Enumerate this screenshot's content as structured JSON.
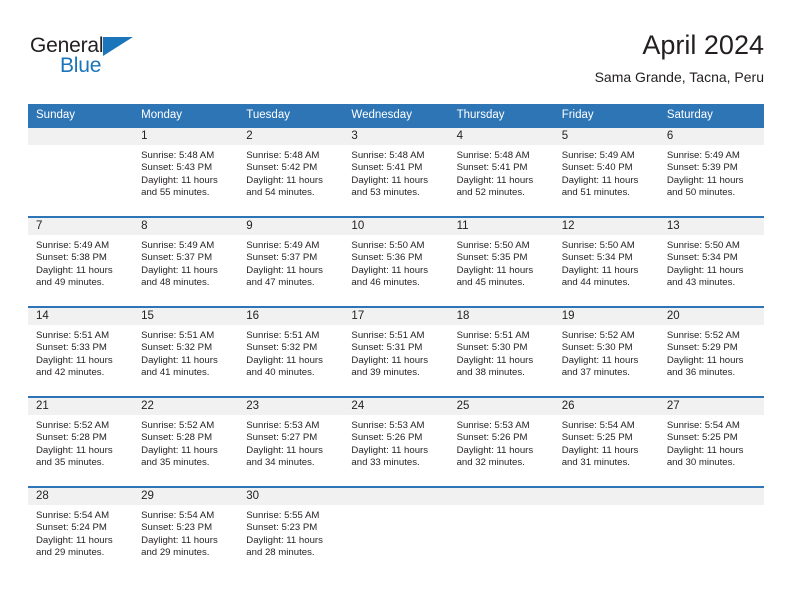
{
  "brand": {
    "name_part1": "General",
    "name_part2": "Blue",
    "triangle_color": "#1b75bb"
  },
  "header": {
    "title": "April 2024",
    "subtitle": "Sama Grande, Tacna, Peru"
  },
  "theme": {
    "header_bg": "#2e75b6",
    "date_band_bg": "#f1f1f1",
    "text": "#231f20",
    "brand_blue": "#1b75bb"
  },
  "weekday_headers": [
    "Sunday",
    "Monday",
    "Tuesday",
    "Wednesday",
    "Thursday",
    "Friday",
    "Saturday"
  ],
  "weeks": [
    [
      {
        "date": "",
        "sunrise": "",
        "sunset": "",
        "daylight_line1": "",
        "daylight_line2": ""
      },
      {
        "date": "1",
        "sunrise": "Sunrise: 5:48 AM",
        "sunset": "Sunset: 5:43 PM",
        "daylight_line1": "Daylight: 11 hours",
        "daylight_line2": "and 55 minutes."
      },
      {
        "date": "2",
        "sunrise": "Sunrise: 5:48 AM",
        "sunset": "Sunset: 5:42 PM",
        "daylight_line1": "Daylight: 11 hours",
        "daylight_line2": "and 54 minutes."
      },
      {
        "date": "3",
        "sunrise": "Sunrise: 5:48 AM",
        "sunset": "Sunset: 5:41 PM",
        "daylight_line1": "Daylight: 11 hours",
        "daylight_line2": "and 53 minutes."
      },
      {
        "date": "4",
        "sunrise": "Sunrise: 5:48 AM",
        "sunset": "Sunset: 5:41 PM",
        "daylight_line1": "Daylight: 11 hours",
        "daylight_line2": "and 52 minutes."
      },
      {
        "date": "5",
        "sunrise": "Sunrise: 5:49 AM",
        "sunset": "Sunset: 5:40 PM",
        "daylight_line1": "Daylight: 11 hours",
        "daylight_line2": "and 51 minutes."
      },
      {
        "date": "6",
        "sunrise": "Sunrise: 5:49 AM",
        "sunset": "Sunset: 5:39 PM",
        "daylight_line1": "Daylight: 11 hours",
        "daylight_line2": "and 50 minutes."
      }
    ],
    [
      {
        "date": "7",
        "sunrise": "Sunrise: 5:49 AM",
        "sunset": "Sunset: 5:38 PM",
        "daylight_line1": "Daylight: 11 hours",
        "daylight_line2": "and 49 minutes."
      },
      {
        "date": "8",
        "sunrise": "Sunrise: 5:49 AM",
        "sunset": "Sunset: 5:37 PM",
        "daylight_line1": "Daylight: 11 hours",
        "daylight_line2": "and 48 minutes."
      },
      {
        "date": "9",
        "sunrise": "Sunrise: 5:49 AM",
        "sunset": "Sunset: 5:37 PM",
        "daylight_line1": "Daylight: 11 hours",
        "daylight_line2": "and 47 minutes."
      },
      {
        "date": "10",
        "sunrise": "Sunrise: 5:50 AM",
        "sunset": "Sunset: 5:36 PM",
        "daylight_line1": "Daylight: 11 hours",
        "daylight_line2": "and 46 minutes."
      },
      {
        "date": "11",
        "sunrise": "Sunrise: 5:50 AM",
        "sunset": "Sunset: 5:35 PM",
        "daylight_line1": "Daylight: 11 hours",
        "daylight_line2": "and 45 minutes."
      },
      {
        "date": "12",
        "sunrise": "Sunrise: 5:50 AM",
        "sunset": "Sunset: 5:34 PM",
        "daylight_line1": "Daylight: 11 hours",
        "daylight_line2": "and 44 minutes."
      },
      {
        "date": "13",
        "sunrise": "Sunrise: 5:50 AM",
        "sunset": "Sunset: 5:34 PM",
        "daylight_line1": "Daylight: 11 hours",
        "daylight_line2": "and 43 minutes."
      }
    ],
    [
      {
        "date": "14",
        "sunrise": "Sunrise: 5:51 AM",
        "sunset": "Sunset: 5:33 PM",
        "daylight_line1": "Daylight: 11 hours",
        "daylight_line2": "and 42 minutes."
      },
      {
        "date": "15",
        "sunrise": "Sunrise: 5:51 AM",
        "sunset": "Sunset: 5:32 PM",
        "daylight_line1": "Daylight: 11 hours",
        "daylight_line2": "and 41 minutes."
      },
      {
        "date": "16",
        "sunrise": "Sunrise: 5:51 AM",
        "sunset": "Sunset: 5:32 PM",
        "daylight_line1": "Daylight: 11 hours",
        "daylight_line2": "and 40 minutes."
      },
      {
        "date": "17",
        "sunrise": "Sunrise: 5:51 AM",
        "sunset": "Sunset: 5:31 PM",
        "daylight_line1": "Daylight: 11 hours",
        "daylight_line2": "and 39 minutes."
      },
      {
        "date": "18",
        "sunrise": "Sunrise: 5:51 AM",
        "sunset": "Sunset: 5:30 PM",
        "daylight_line1": "Daylight: 11 hours",
        "daylight_line2": "and 38 minutes."
      },
      {
        "date": "19",
        "sunrise": "Sunrise: 5:52 AM",
        "sunset": "Sunset: 5:30 PM",
        "daylight_line1": "Daylight: 11 hours",
        "daylight_line2": "and 37 minutes."
      },
      {
        "date": "20",
        "sunrise": "Sunrise: 5:52 AM",
        "sunset": "Sunset: 5:29 PM",
        "daylight_line1": "Daylight: 11 hours",
        "daylight_line2": "and 36 minutes."
      }
    ],
    [
      {
        "date": "21",
        "sunrise": "Sunrise: 5:52 AM",
        "sunset": "Sunset: 5:28 PM",
        "daylight_line1": "Daylight: 11 hours",
        "daylight_line2": "and 35 minutes."
      },
      {
        "date": "22",
        "sunrise": "Sunrise: 5:52 AM",
        "sunset": "Sunset: 5:28 PM",
        "daylight_line1": "Daylight: 11 hours",
        "daylight_line2": "and 35 minutes."
      },
      {
        "date": "23",
        "sunrise": "Sunrise: 5:53 AM",
        "sunset": "Sunset: 5:27 PM",
        "daylight_line1": "Daylight: 11 hours",
        "daylight_line2": "and 34 minutes."
      },
      {
        "date": "24",
        "sunrise": "Sunrise: 5:53 AM",
        "sunset": "Sunset: 5:26 PM",
        "daylight_line1": "Daylight: 11 hours",
        "daylight_line2": "and 33 minutes."
      },
      {
        "date": "25",
        "sunrise": "Sunrise: 5:53 AM",
        "sunset": "Sunset: 5:26 PM",
        "daylight_line1": "Daylight: 11 hours",
        "daylight_line2": "and 32 minutes."
      },
      {
        "date": "26",
        "sunrise": "Sunrise: 5:54 AM",
        "sunset": "Sunset: 5:25 PM",
        "daylight_line1": "Daylight: 11 hours",
        "daylight_line2": "and 31 minutes."
      },
      {
        "date": "27",
        "sunrise": "Sunrise: 5:54 AM",
        "sunset": "Sunset: 5:25 PM",
        "daylight_line1": "Daylight: 11 hours",
        "daylight_line2": "and 30 minutes."
      }
    ],
    [
      {
        "date": "28",
        "sunrise": "Sunrise: 5:54 AM",
        "sunset": "Sunset: 5:24 PM",
        "daylight_line1": "Daylight: 11 hours",
        "daylight_line2": "and 29 minutes."
      },
      {
        "date": "29",
        "sunrise": "Sunrise: 5:54 AM",
        "sunset": "Sunset: 5:23 PM",
        "daylight_line1": "Daylight: 11 hours",
        "daylight_line2": "and 29 minutes."
      },
      {
        "date": "30",
        "sunrise": "Sunrise: 5:55 AM",
        "sunset": "Sunset: 5:23 PM",
        "daylight_line1": "Daylight: 11 hours",
        "daylight_line2": "and 28 minutes."
      },
      {
        "date": "",
        "sunrise": "",
        "sunset": "",
        "daylight_line1": "",
        "daylight_line2": ""
      },
      {
        "date": "",
        "sunrise": "",
        "sunset": "",
        "daylight_line1": "",
        "daylight_line2": ""
      },
      {
        "date": "",
        "sunrise": "",
        "sunset": "",
        "daylight_line1": "",
        "daylight_line2": ""
      },
      {
        "date": "",
        "sunrise": "",
        "sunset": "",
        "daylight_line1": "",
        "daylight_line2": ""
      }
    ]
  ]
}
